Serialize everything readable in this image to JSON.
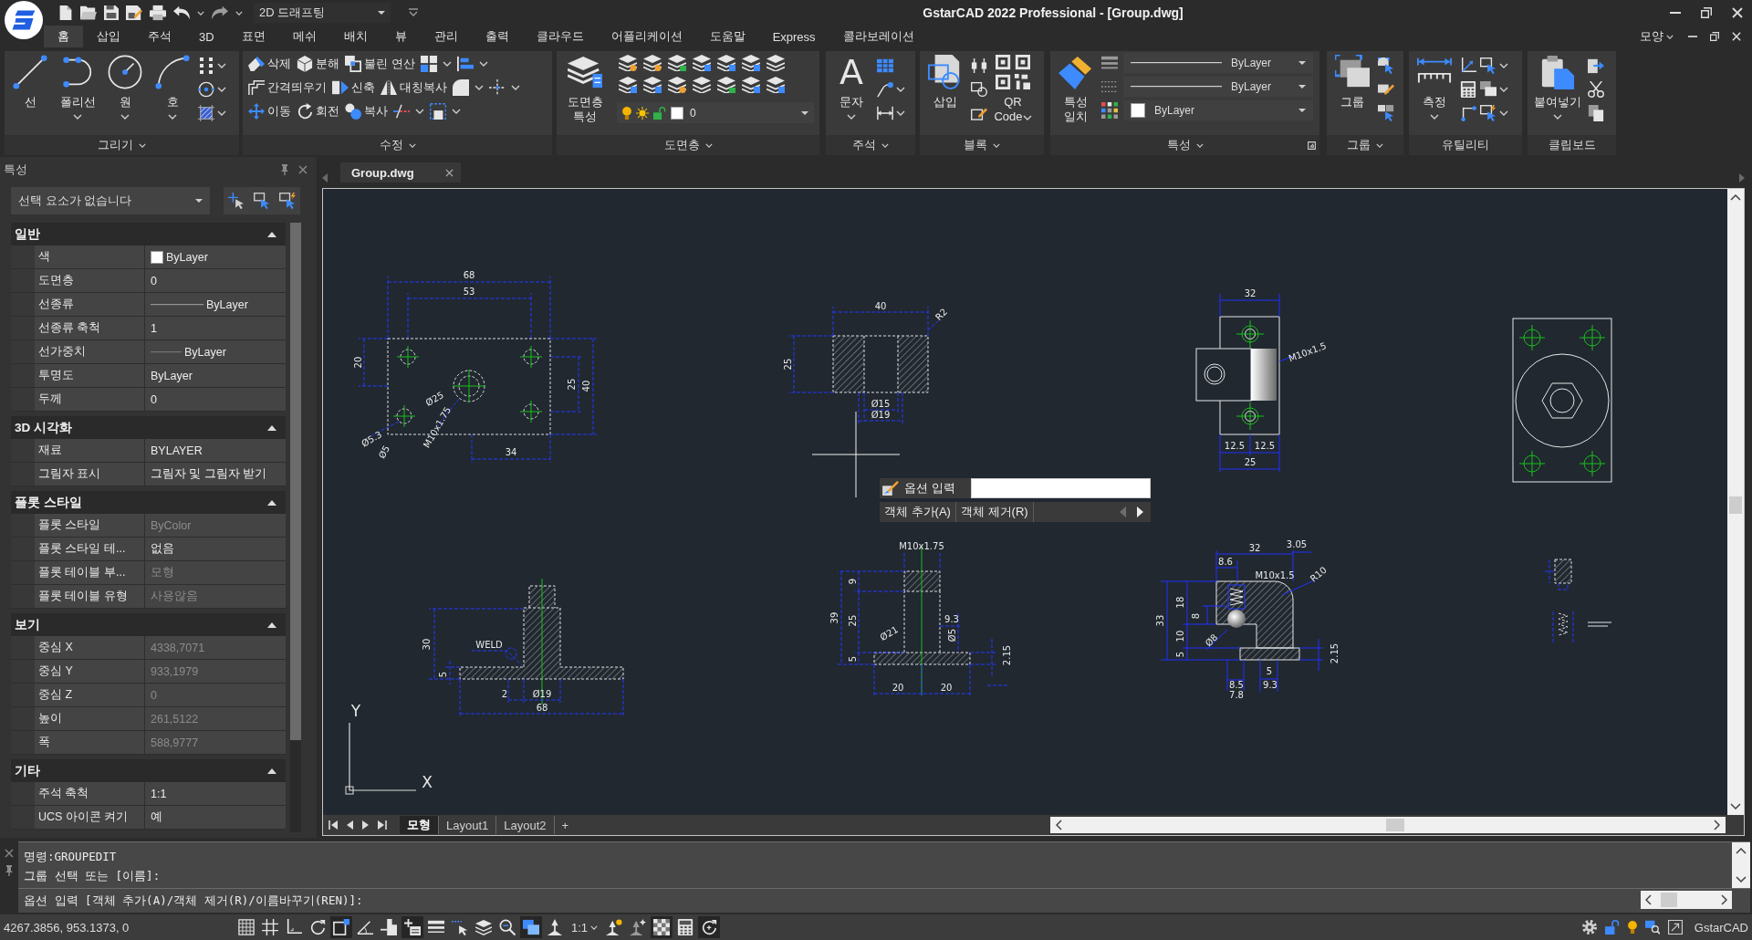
{
  "title_bar": {
    "workspace": "2D 드래프팅",
    "title": "GstarCAD 2022 Professional - [Group.dwg]"
  },
  "ribbon_tabs": [
    {
      "label": "홈",
      "selected": true
    },
    {
      "label": "삽입",
      "selected": false
    },
    {
      "label": "주석",
      "selected": false
    },
    {
      "label": "3D",
      "selected": false
    },
    {
      "label": "표면",
      "selected": false
    },
    {
      "label": "메쉬",
      "selected": false
    },
    {
      "label": "배치",
      "selected": false
    },
    {
      "label": "뷰",
      "selected": false
    },
    {
      "label": "관리",
      "selected": false
    },
    {
      "label": "출력",
      "selected": false
    },
    {
      "label": "클라우드",
      "selected": false
    },
    {
      "label": "어플리케이션",
      "selected": false
    },
    {
      "label": "도움말",
      "selected": false
    },
    {
      "label": "Express",
      "selected": false
    },
    {
      "label": "콜라보레이션",
      "selected": false
    }
  ],
  "appearance_menu": "모양",
  "ribbon": {
    "draw": {
      "title": "그리기",
      "tools": [
        "선",
        "폴리선",
        "원",
        "호"
      ]
    },
    "modify": {
      "title": "수정",
      "rows": [
        [
          "삭제",
          "분해",
          "불린 연산"
        ],
        [
          "간격띄우기",
          "신축",
          "대칭복사"
        ],
        [
          "이동",
          "회전",
          "복사"
        ]
      ]
    },
    "layers": {
      "title": "도면층",
      "tool": "도면층 특성",
      "current_layer": "0"
    },
    "annotation": {
      "title": "주석",
      "tool": "문자",
      "tool_glyph": "A"
    },
    "block": {
      "title": "블록",
      "tools": [
        "삽입",
        "QR Code"
      ]
    },
    "properties": {
      "title": "특성",
      "tool": "특성 일치",
      "lineweight_setting": "ByLayer",
      "linetype_setting": "ByLayer",
      "color_setting": "ByLayer"
    },
    "group": {
      "title": "그룹",
      "tool": "그룹"
    },
    "utilities": {
      "title": "유틸리티",
      "tool": "측정"
    },
    "clipboard": {
      "title": "클립보드",
      "tool": "붙여넣기"
    }
  },
  "palette": {
    "title": "특성",
    "selection": "선택 요소가 없습니다",
    "sections": [
      {
        "title": "일반",
        "expanded": true,
        "rows": [
          {
            "label": "색",
            "value": "ByLayer",
            "kind": "color",
            "disabled": false
          },
          {
            "label": "도면층",
            "value": "0",
            "kind": "text",
            "disabled": false
          },
          {
            "label": "선종류",
            "value": "ByLayer",
            "kind": "linetype",
            "disabled": false
          },
          {
            "label": "선종류 축척",
            "value": "1",
            "kind": "text",
            "disabled": false
          },
          {
            "label": "선가중치",
            "value": "ByLayer",
            "kind": "lineweight",
            "disabled": false
          },
          {
            "label": "투명도",
            "value": "ByLayer",
            "kind": "text",
            "disabled": false
          },
          {
            "label": "두께",
            "value": "0",
            "kind": "text",
            "disabled": false
          }
        ]
      },
      {
        "title": "3D 시각화",
        "expanded": true,
        "rows": [
          {
            "label": "재료",
            "value": "BYLAYER",
            "kind": "text",
            "disabled": false
          },
          {
            "label": "그림자 표시",
            "value": "그림자 및 그림자 받기",
            "kind": "text",
            "disabled": false
          }
        ]
      },
      {
        "title": "플롯 스타일",
        "expanded": true,
        "rows": [
          {
            "label": "플롯 스타일",
            "value": "ByColor",
            "kind": "text",
            "disabled": true
          },
          {
            "label": "플롯 스타일 테...",
            "value": "없음",
            "kind": "text",
            "disabled": false
          },
          {
            "label": "플롯 테이블 부...",
            "value": "모형",
            "kind": "text",
            "disabled": true
          },
          {
            "label": "플롯 테이블 유형",
            "value": "사용않음",
            "kind": "text",
            "disabled": true
          }
        ]
      },
      {
        "title": "보기",
        "expanded": true,
        "rows": [
          {
            "label": "중심 X",
            "value": "4338,7071",
            "kind": "text",
            "disabled": true
          },
          {
            "label": "중심 Y",
            "value": "933,1979",
            "kind": "text",
            "disabled": true
          },
          {
            "label": "중심 Z",
            "value": "0",
            "kind": "text",
            "disabled": true
          },
          {
            "label": "높이",
            "value": "261,5122",
            "kind": "text",
            "disabled": true
          },
          {
            "label": "폭",
            "value": "588,9777",
            "kind": "text",
            "disabled": true
          }
        ]
      },
      {
        "title": "기타",
        "expanded": true,
        "rows": [
          {
            "label": "주석 축척",
            "value": "1:1",
            "kind": "text",
            "disabled": false
          },
          {
            "label": "UCS 아이콘 켜기",
            "value": "예",
            "kind": "text",
            "disabled": false
          }
        ]
      }
    ]
  },
  "document_tab": {
    "label": "Group.dwg"
  },
  "canvas": {
    "drawings": [
      {
        "labels": [
          "68",
          "53",
          "20",
          "25",
          "40",
          "Ø5.3",
          "Ø5",
          "Ø25",
          "M10x1.75",
          "34"
        ]
      },
      {
        "labels": [
          "40",
          "R2",
          "25",
          "Ø15",
          "Ø19"
        ]
      },
      {
        "labels": [
          "32",
          "M10x1.5",
          "12.5",
          "12.5",
          "25"
        ]
      },
      {
        "labels": [
          "30",
          "WELD",
          "5",
          "2",
          "Ø19",
          "68"
        ]
      },
      {
        "labels": [
          "M10x1.75",
          "9",
          "39",
          "25",
          "Ø21",
          "9.3",
          "Ø5",
          "2.15",
          "5",
          "20",
          "20"
        ]
      },
      {
        "labels": [
          "32",
          "3.05",
          "8.6",
          "M10x1.5",
          "R10",
          "33",
          "18",
          "8",
          "10",
          "5",
          "Ø8",
          "2.15",
          "5",
          "8.5",
          "7.8",
          "9.3"
        ]
      }
    ],
    "option_prompt": {
      "label": "옵션 입력",
      "options": [
        "객체 추가(A)",
        "객체 제거(R)"
      ],
      "previous_enabled": false,
      "next_enabled": true
    },
    "ucs": {
      "x_label": "X",
      "y_label": "Y"
    }
  },
  "layout_tabs": [
    {
      "label": "모형",
      "selected": true
    },
    {
      "label": "Layout1",
      "selected": false
    },
    {
      "label": "Layout2",
      "selected": false
    }
  ],
  "new_layout": "+",
  "command_line": {
    "history": [
      "명령:GROUPEDIT",
      "그룹 선택 또는 [이름]:"
    ],
    "prompt": "옵션 입력 [객체 추가(A)/객체 제거(R)/이름바꾸기(REN)]:"
  },
  "status_bar": {
    "coordinates": "4267.3856, 953.1373, 0",
    "toggles": [
      {
        "on": false
      },
      {
        "on": false
      },
      {
        "on": false
      },
      {
        "on": false
      },
      {
        "on": true
      },
      {
        "on": false
      },
      {
        "on": false
      },
      {
        "on": true
      },
      {
        "on": false
      },
      {
        "on": false
      },
      {
        "on": false
      },
      {
        "on": false
      },
      {
        "on": true
      },
      {
        "on": false
      }
    ],
    "annotation_scale": "1:1",
    "more_toggles": [
      {
        "on": false
      },
      {
        "on": false
      },
      {
        "on": true
      },
      {
        "on": false
      },
      {
        "on": true
      }
    ],
    "app_label": "GstarCAD"
  }
}
